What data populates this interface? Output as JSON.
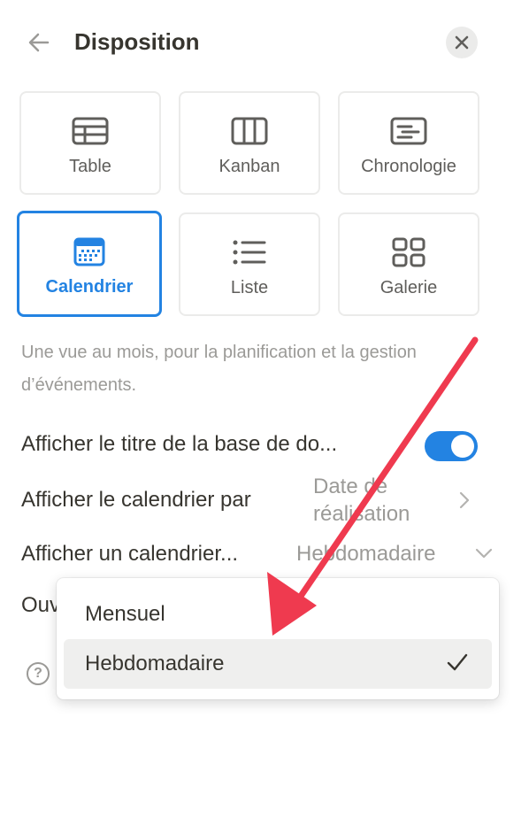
{
  "header": {
    "title": "Disposition",
    "back_icon": "arrow-left-icon",
    "close_icon": "close-icon"
  },
  "layouts": [
    {
      "label": "Table",
      "icon": "table-icon",
      "selected": false
    },
    {
      "label": "Kanban",
      "icon": "kanban-icon",
      "selected": false
    },
    {
      "label": "Chronologie",
      "icon": "timeline-icon",
      "selected": false
    },
    {
      "label": "Calendrier",
      "icon": "calendar-icon",
      "selected": true
    },
    {
      "label": "Liste",
      "icon": "list-icon",
      "selected": false
    },
    {
      "label": "Galerie",
      "icon": "gallery-icon",
      "selected": false
    }
  ],
  "description": "Une vue au mois, pour la planification et la gestion d’événements.",
  "settings": {
    "show_title": {
      "label": "Afficher le titre de la base de do...",
      "enabled": true
    },
    "show_by": {
      "label": "Afficher le calendrier par",
      "value_line1": "Date de",
      "value_line2": "réalisation"
    },
    "show_calendar": {
      "label": "Afficher un calendrier...",
      "value": "Hebdomadaire"
    },
    "open_partial": "Ouv"
  },
  "help_label": "?",
  "dropdown": {
    "options": [
      {
        "label": "Mensuel",
        "selected": false
      },
      {
        "label": "Hebdomadaire",
        "selected": true
      }
    ],
    "check_glyph": "✓"
  },
  "colors": {
    "accent": "#2383e2",
    "annotation_arrow": "#ef3a4f",
    "muted_text": "#9b9a97"
  }
}
